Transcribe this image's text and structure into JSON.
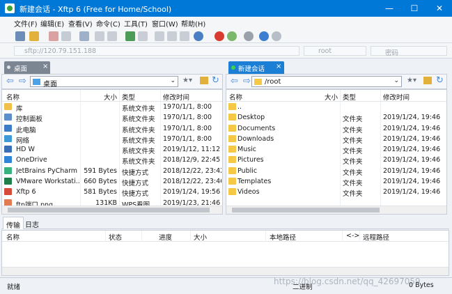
{
  "window": {
    "title": "新建会话 - Xftp 6 (Free for Home/School)",
    "min_glyph": "—",
    "max_glyph": "☐",
    "close_glyph": "✕"
  },
  "menu": [
    "文件(F)",
    "编辑(E)",
    "查看(V)",
    "命令(C)",
    "工具(T)",
    "窗口(W)",
    "帮助(H)"
  ],
  "address": {
    "host": "sftp://120.79.151.188",
    "user_placeholder": "root",
    "password_placeholder": "密码"
  },
  "tabs": {
    "left": "桌面",
    "right": "新建会话",
    "close": "×"
  },
  "left_pane": {
    "path": "桌面",
    "columns": [
      "名称",
      "大小",
      "类型",
      "修改时间"
    ],
    "rows": [
      {
        "name": "库",
        "size": "",
        "type": "系统文件夹",
        "modified": "1970/1/1, 8:00"
      },
      {
        "name": "控制面板",
        "size": "",
        "type": "系统文件夹",
        "modified": "1970/1/1, 8:00"
      },
      {
        "name": "此电脑",
        "size": "",
        "type": "系统文件夹",
        "modified": "1970/1/1, 8:00"
      },
      {
        "name": "网络",
        "size": "",
        "type": "系统文件夹",
        "modified": "1970/1/1, 8:00"
      },
      {
        "name": "HD W",
        "size": "",
        "type": "系统文件夹",
        "modified": "2019/1/12, 11:12"
      },
      {
        "name": "OneDrive",
        "size": "",
        "type": "系统文件夹",
        "modified": "2018/12/9, 22:45"
      },
      {
        "name": "JetBrains PyCharm ...",
        "size": "591 Bytes",
        "type": "快捷方式",
        "modified": "2018/12/22, 23:42"
      },
      {
        "name": "VMware Workstati...",
        "size": "660 Bytes",
        "type": "快捷方式",
        "modified": "2018/12/22, 23:46"
      },
      {
        "name": "Xftp 6",
        "size": "581 Bytes",
        "type": "快捷方式",
        "modified": "2019/1/24, 19:56"
      },
      {
        "name": "ftp端口.png",
        "size": "131KB",
        "type": "WPS看图",
        "modified": "2019/1/23, 21:46"
      }
    ]
  },
  "right_pane": {
    "path": "/root",
    "columns": [
      "名称",
      "大小",
      "类型",
      "修改时间"
    ],
    "rows": [
      {
        "name": "..",
        "size": "",
        "type": "",
        "modified": ""
      },
      {
        "name": "Desktop",
        "size": "",
        "type": "文件夹",
        "modified": "2019/1/24, 19:46"
      },
      {
        "name": "Documents",
        "size": "",
        "type": "文件夹",
        "modified": "2019/1/24, 19:46"
      },
      {
        "name": "Downloads",
        "size": "",
        "type": "文件夹",
        "modified": "2019/1/24, 19:46"
      },
      {
        "name": "Music",
        "size": "",
        "type": "文件夹",
        "modified": "2019/1/24, 19:46"
      },
      {
        "name": "Pictures",
        "size": "",
        "type": "文件夹",
        "modified": "2019/1/24, 19:46"
      },
      {
        "name": "Public",
        "size": "",
        "type": "文件夹",
        "modified": "2019/1/24, 19:46"
      },
      {
        "name": "Templates",
        "size": "",
        "type": "文件夹",
        "modified": "2019/1/24, 19:46"
      },
      {
        "name": "Videos",
        "size": "",
        "type": "文件夹",
        "modified": "2019/1/24, 19:46"
      }
    ]
  },
  "bottom_tabs": [
    "传输",
    "日志"
  ],
  "transfer_columns": [
    "名称",
    "状态",
    "进度",
    "大小",
    "本地路径",
    "<->",
    "远程路径"
  ],
  "status": {
    "left": "就绪",
    "mode": "二进制",
    "size": "0 Bytes"
  },
  "watermark": "https://blog.csdn.net/qq_42697059",
  "colors": {
    "titlebar": "#0078d7",
    "active_tab": "#1c7fd6",
    "inactive_tab": "#7c8592"
  }
}
